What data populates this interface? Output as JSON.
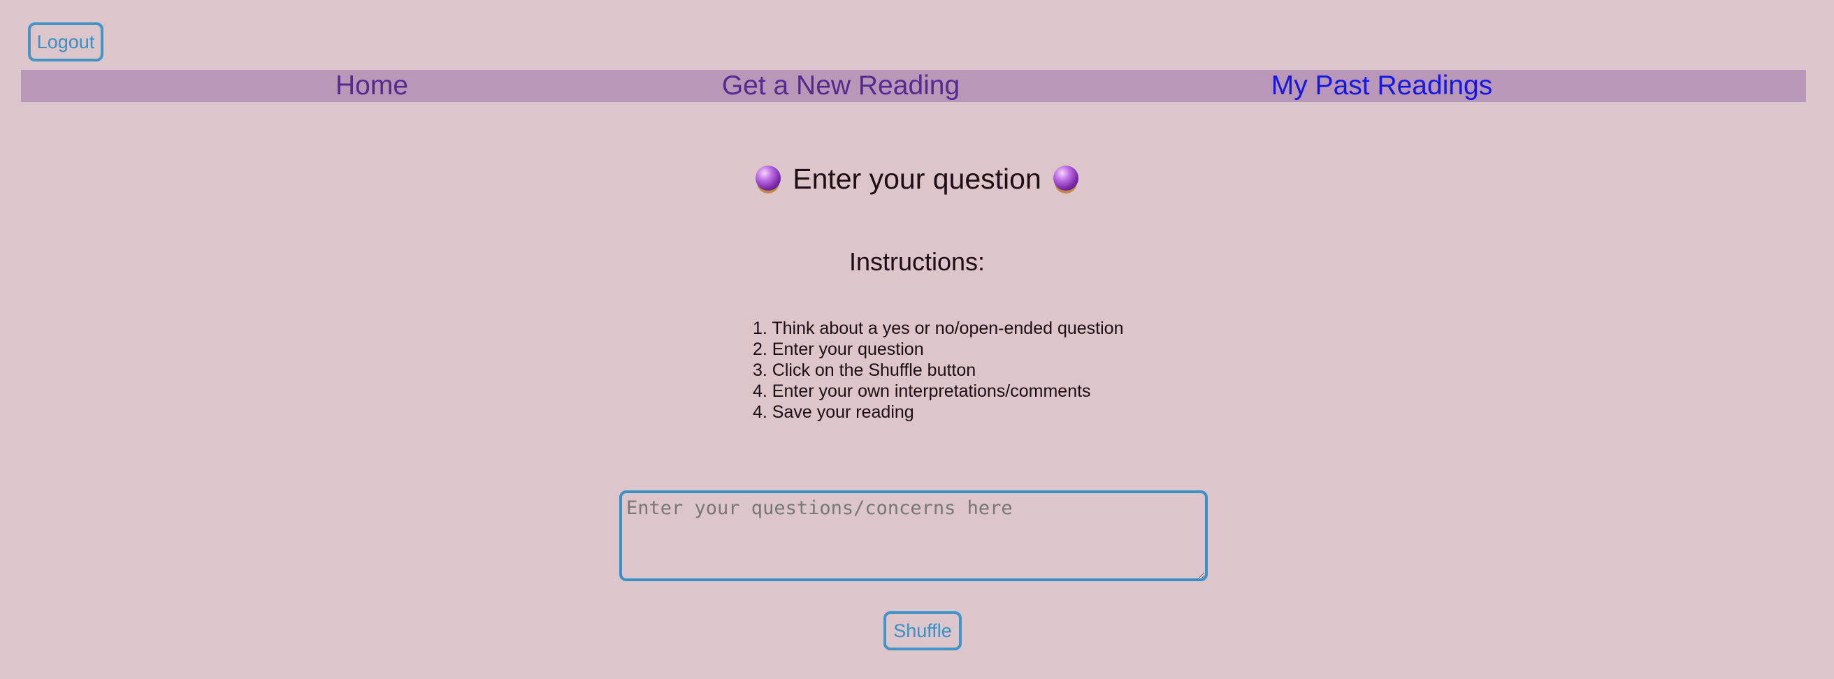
{
  "auth": {
    "logout_label": "Logout"
  },
  "nav": {
    "items": [
      {
        "label": "Home",
        "color": "#552a8f"
      },
      {
        "label": "Get a New Reading",
        "color": "#552a8f"
      },
      {
        "label": "My Past Readings",
        "color": "#1717e3"
      }
    ]
  },
  "main": {
    "title": "Enter your question",
    "title_icon": "crystal-ball-icon",
    "instructions_heading": "Instructions:",
    "steps": [
      "1. Think about a yes or no/open-ended question",
      "2. Enter your question",
      "3. Click on the Shuffle button",
      "4. Enter your own interpretations/comments",
      "4. Save your reading"
    ],
    "question_input": {
      "placeholder": "Enter your questions/concerns here",
      "value": ""
    },
    "shuffle_label": "Shuffle"
  },
  "colors": {
    "background": "#dcc5cb",
    "navbar": "#b997b8",
    "accent_border": "#4394c9"
  }
}
